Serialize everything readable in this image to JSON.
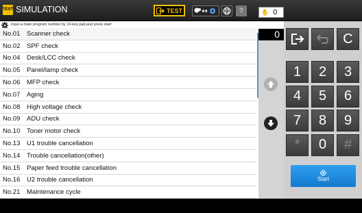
{
  "header": {
    "badge": "TEST",
    "title": "SIMULATION",
    "test_button_label": "TEST",
    "help_label": "?",
    "copy_count": "0"
  },
  "instruction": "Input a main program number by 10-key pad,and press start",
  "entry_value": "0",
  "list": [
    {
      "no": "No.01",
      "label": "Scanner check"
    },
    {
      "no": "No.02",
      "label": "SPF check"
    },
    {
      "no": "No.04",
      "label": "Desk/LCC check"
    },
    {
      "no": "No.05",
      "label": "Panel/lamp check"
    },
    {
      "no": "No.06",
      "label": "MFP check"
    },
    {
      "no": "No.07",
      "label": "Aging"
    },
    {
      "no": "No.08",
      "label": "High voltage check"
    },
    {
      "no": "No.09",
      "label": "ADU check"
    },
    {
      "no": "No.10",
      "label": "Toner motor check"
    },
    {
      "no": "No.13",
      "label": "U1 trouble cancellation"
    },
    {
      "no": "No.14",
      "label": "Trouble cancellation(other)"
    },
    {
      "no": "No.15",
      "label": "Paper feed trouble cancellation"
    },
    {
      "no": "No.16",
      "label": "U2 trouble cancellation"
    },
    {
      "no": "No.21",
      "label": "Maintenance cycle"
    }
  ],
  "keypad": {
    "clear": "C",
    "keys": [
      "1",
      "2",
      "3",
      "4",
      "5",
      "6",
      "7",
      "8",
      "9",
      "*",
      "0",
      "#"
    ],
    "start_label": "Start"
  },
  "colors": {
    "accent_yellow": "#f2c200",
    "start_blue": "#1e8ae0",
    "scroll_blue": "#5a8cd6"
  }
}
